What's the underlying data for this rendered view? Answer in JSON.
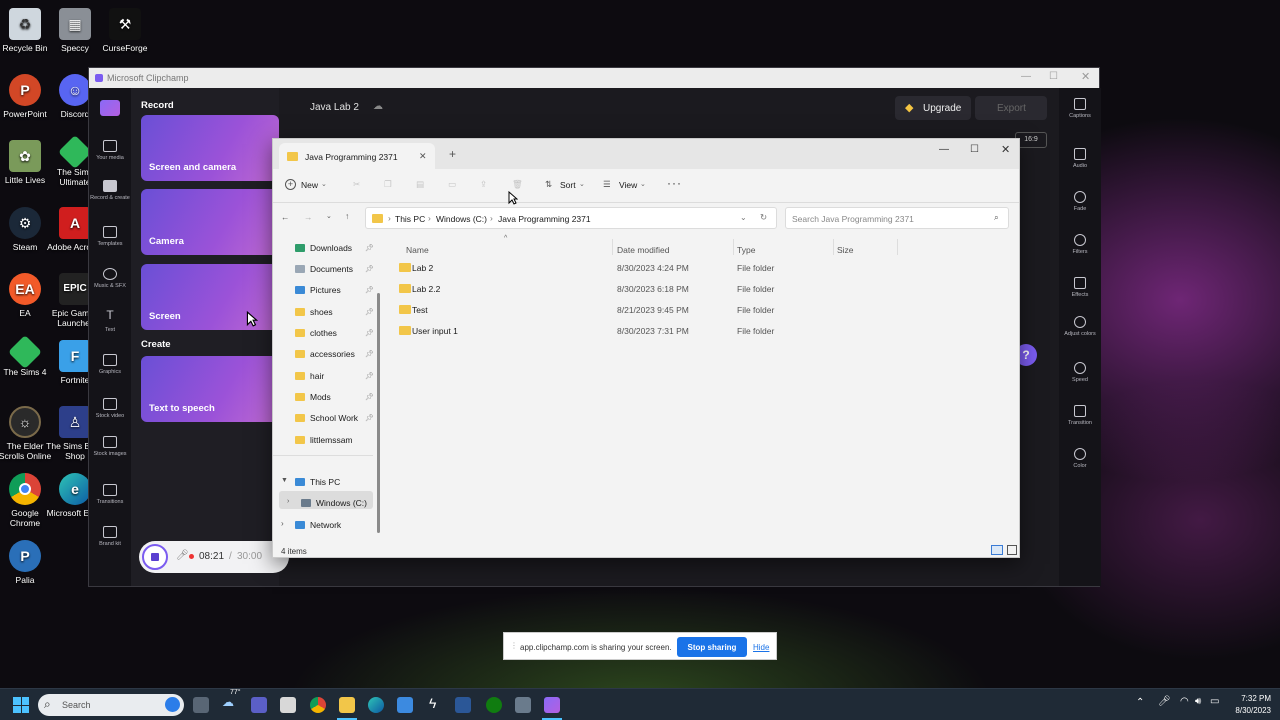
{
  "desktop": {
    "icons": [
      {
        "label": "Recycle Bin"
      },
      {
        "label": "Speccy"
      },
      {
        "label": "CurseForge"
      },
      {
        "label": "PowerPoint"
      },
      {
        "label": "Discord"
      },
      {
        "label": "Little Lives"
      },
      {
        "label": "The Sims Ultimate"
      },
      {
        "label": "Steam"
      },
      {
        "label": "Adobe Acrobat"
      },
      {
        "label": "EA"
      },
      {
        "label": "Epic Games Launcher"
      },
      {
        "label": "The Sims 4"
      },
      {
        "label": "Fortnite"
      },
      {
        "label": "The Elder Scrolls Online"
      },
      {
        "label": "The Sims Body Shop"
      },
      {
        "label": "Google Chrome"
      },
      {
        "label": "Microsoft Edge"
      },
      {
        "label": "Palia"
      }
    ]
  },
  "clipchamp": {
    "window_title": "Microsoft Clipchamp",
    "project_name": "Java Lab 2",
    "upgrade_label": "Upgrade",
    "export_label": "Export",
    "aspect_ratio": "16:9",
    "record_heading": "Record",
    "create_heading": "Create",
    "cards": [
      "Screen and camera",
      "Camera",
      "Screen",
      "Text to speech"
    ],
    "left_rail": [
      "Your media",
      "Record & create",
      "Templates",
      "Music & SFX",
      "Text",
      "Graphics",
      "Stock video",
      "Stock images",
      "Transitions",
      "Brand kit"
    ],
    "right_rail": [
      "Captions",
      "Audio",
      "Fade",
      "Filters",
      "Effects",
      "Adjust colors",
      "Speed",
      "Transition",
      "Color"
    ],
    "recorder": {
      "elapsed": "08:21",
      "separator": "/",
      "limit": "30:00"
    }
  },
  "explorer": {
    "tab_title": "Java Programming 2371",
    "toolbar": {
      "new_label": "New",
      "sort_label": "Sort",
      "view_label": "View"
    },
    "breadcrumb": [
      "This PC",
      "Windows (C:)",
      "Java Programming 2371"
    ],
    "search_placeholder": "Search Java Programming 2371",
    "nav_quick": [
      "Downloads",
      "Documents",
      "Pictures",
      "shoes",
      "clothes",
      "accessories",
      "hair",
      "Mods",
      "School Work",
      "littlemssam"
    ],
    "nav_tree": [
      "This PC",
      "Windows (C:)",
      "Network"
    ],
    "columns": {
      "name": "Name",
      "date": "Date modified",
      "type": "Type",
      "size": "Size"
    },
    "files": [
      {
        "name": "Lab 2",
        "date": "8/30/2023 4:24 PM",
        "type": "File folder"
      },
      {
        "name": "Lab 2.2",
        "date": "8/30/2023 6:18 PM",
        "type": "File folder"
      },
      {
        "name": "Test",
        "date": "8/21/2023 9:45 PM",
        "type": "File folder"
      },
      {
        "name": "User input 1",
        "date": "8/30/2023 7:31 PM",
        "type": "File folder"
      }
    ],
    "status": "4 items"
  },
  "share_bar": {
    "message": "app.clipchamp.com is sharing your screen.",
    "stop_label": "Stop sharing",
    "hide_label": "Hide"
  },
  "taskbar": {
    "search_placeholder": "Search",
    "weather_temp": "77°",
    "time": "7:32 PM",
    "date": "8/30/2023"
  }
}
